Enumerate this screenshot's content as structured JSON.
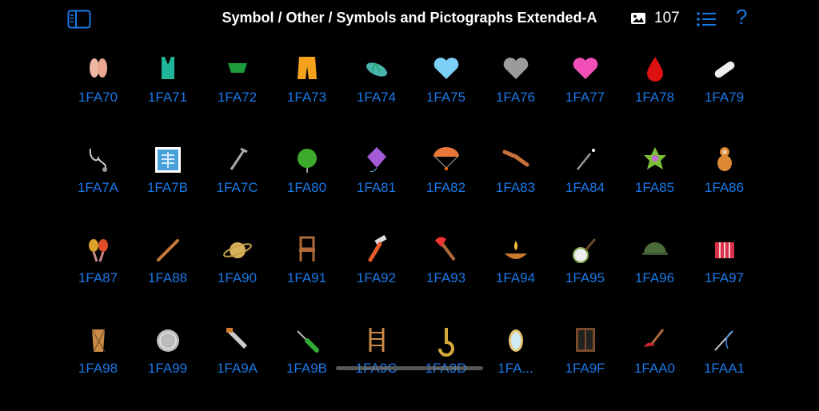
{
  "header": {
    "title": "Symbol / Other / Symbols and Pictographs Extended-A",
    "count": "107",
    "help_label": "?"
  },
  "icons": {
    "sidebar": "sidebar-toggle-icon",
    "gallery": "photo-icon",
    "list": "list-icon",
    "help": "question-mark-icon"
  },
  "accent_color": "#1a78e6",
  "symbols": [
    {
      "code": "1FA70",
      "name": "ballet-shoes"
    },
    {
      "code": "1FA71",
      "name": "one-piece-swimsuit"
    },
    {
      "code": "1FA72",
      "name": "briefs"
    },
    {
      "code": "1FA73",
      "name": "shorts"
    },
    {
      "code": "1FA74",
      "name": "thong-sandal"
    },
    {
      "code": "1FA75",
      "name": "light-blue-heart"
    },
    {
      "code": "1FA76",
      "name": "grey-heart"
    },
    {
      "code": "1FA77",
      "name": "pink-heart"
    },
    {
      "code": "1FA78",
      "name": "drop-of-blood"
    },
    {
      "code": "1FA79",
      "name": "adhesive-bandage"
    },
    {
      "code": "1FA7A",
      "name": "stethoscope"
    },
    {
      "code": "1FA7B",
      "name": "x-ray"
    },
    {
      "code": "1FA7C",
      "name": "crutch"
    },
    {
      "code": "1FA80",
      "name": "yo-yo"
    },
    {
      "code": "1FA81",
      "name": "kite"
    },
    {
      "code": "1FA82",
      "name": "parachute"
    },
    {
      "code": "1FA83",
      "name": "boomerang"
    },
    {
      "code": "1FA84",
      "name": "magic-wand"
    },
    {
      "code": "1FA85",
      "name": "pinata"
    },
    {
      "code": "1FA86",
      "name": "nesting-dolls"
    },
    {
      "code": "1FA87",
      "name": "maracas"
    },
    {
      "code": "1FA88",
      "name": "flute"
    },
    {
      "code": "1FA90",
      "name": "ringed-planet"
    },
    {
      "code": "1FA91",
      "name": "chair"
    },
    {
      "code": "1FA92",
      "name": "razor"
    },
    {
      "code": "1FA93",
      "name": "axe"
    },
    {
      "code": "1FA94",
      "name": "diya-lamp"
    },
    {
      "code": "1FA95",
      "name": "banjo"
    },
    {
      "code": "1FA96",
      "name": "military-helmet"
    },
    {
      "code": "1FA97",
      "name": "accordion"
    },
    {
      "code": "1FA98",
      "name": "long-drum"
    },
    {
      "code": "1FA99",
      "name": "coin"
    },
    {
      "code": "1FA9A",
      "name": "carpentry-saw"
    },
    {
      "code": "1FA9B",
      "name": "screwdriver"
    },
    {
      "code": "1FA9C",
      "name": "ladder"
    },
    {
      "code": "1FA9D",
      "name": "hook"
    },
    {
      "code": "1FA...",
      "name": "mirror"
    },
    {
      "code": "1FA9F",
      "name": "window"
    },
    {
      "code": "1FAA0",
      "name": "plunger"
    },
    {
      "code": "1FAA1",
      "name": "sewing-needle"
    }
  ]
}
